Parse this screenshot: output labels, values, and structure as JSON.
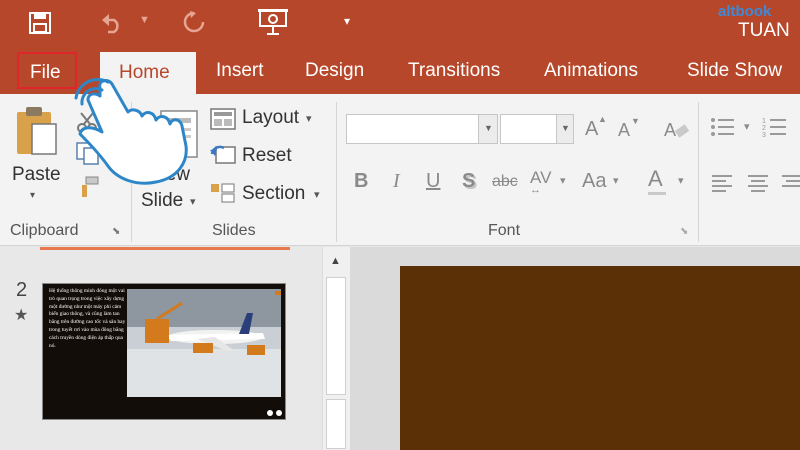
{
  "title_bar": {
    "user_name": "TUAN",
    "watermark": "altbook"
  },
  "tabs": [
    {
      "label": "File"
    },
    {
      "label": "Home"
    },
    {
      "label": "Insert"
    },
    {
      "label": "Design"
    },
    {
      "label": "Transitions"
    },
    {
      "label": "Animations"
    },
    {
      "label": "Slide Show"
    }
  ],
  "clipboard": {
    "paste_label": "Paste",
    "group_label": "Clipboard"
  },
  "slides_group": {
    "new_slide_top": "New",
    "new_slide_bottom": "Slide",
    "layout_label": "Layout",
    "reset_label": "Reset",
    "section_label": "Section",
    "group_label": "Slides"
  },
  "font_group": {
    "group_label": "Font",
    "bold": "B",
    "italic": "I",
    "underline": "U",
    "shadow": "S",
    "strikethrough": "abc",
    "spacing": "AV",
    "change_case": "Aa",
    "font_color": "A",
    "grow": "A",
    "shrink": "A"
  },
  "thumbnails": [
    {
      "number": "2",
      "star": "★",
      "text": "Hệ thống thông minh đóng một vai trò quan trọng trong việc xây dựng một đường như một máy phi cảm biến giao thông, và cũng làm tan băng trên đường cao tốc và sân bay trong tuyết rơi vào mùa đông bằng cách truyền dòng điện áp thấp qua nó."
    }
  ],
  "colors": {
    "accent": "#b7472a",
    "ribbon": "#f3f3f3",
    "slide_background": "#5b3006",
    "highlight_box": "#e0262a"
  }
}
